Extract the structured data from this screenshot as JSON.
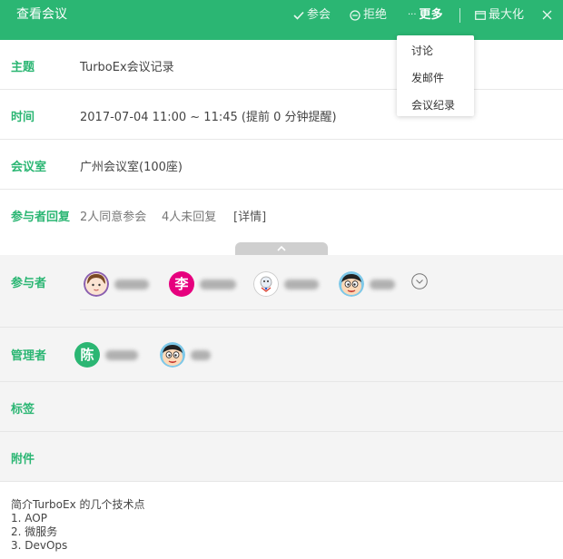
{
  "header": {
    "title": "查看会议",
    "accept_label": "参会",
    "decline_label": "拒绝",
    "more_prefix": "···",
    "more_label": "更多",
    "maximize_label": "最大化"
  },
  "fields": {
    "subject_label": "主题",
    "subject_value": "TurboEx会议记录",
    "time_label": "时间",
    "time_value": "2017-07-04 11:00 ~ 11:45 (提前 0 分钟提醒)",
    "room_label": "会议室",
    "room_value": "广州会议室(100座)",
    "reply_label": "参与者回复",
    "reply_agreed": "2人同意参会",
    "reply_pending": "4人未回复",
    "reply_detail": "[详情]",
    "participants_label": "参与者",
    "admins_label": "管理者",
    "tags_label": "标签",
    "attachments_label": "附件"
  },
  "participants": [
    {
      "avatar_text": ""
    },
    {
      "avatar_text": "李"
    },
    {
      "avatar_text": ""
    },
    {
      "avatar_text": ""
    }
  ],
  "admins": [
    {
      "avatar_text": "陈"
    },
    {
      "avatar_text": ""
    }
  ],
  "description": {
    "line1": "简介TurboEx 的几个技术点",
    "line2": "1. AOP",
    "line3": "2. 微服务",
    "line4": "3. DevOps"
  },
  "more_menu": {
    "items": [
      "讨论",
      "发邮件",
      "会议纪录"
    ]
  },
  "colors": {
    "accent": "#2bb673",
    "avatar_pink": "#e6007e",
    "avatar_green": "#2bb673"
  }
}
